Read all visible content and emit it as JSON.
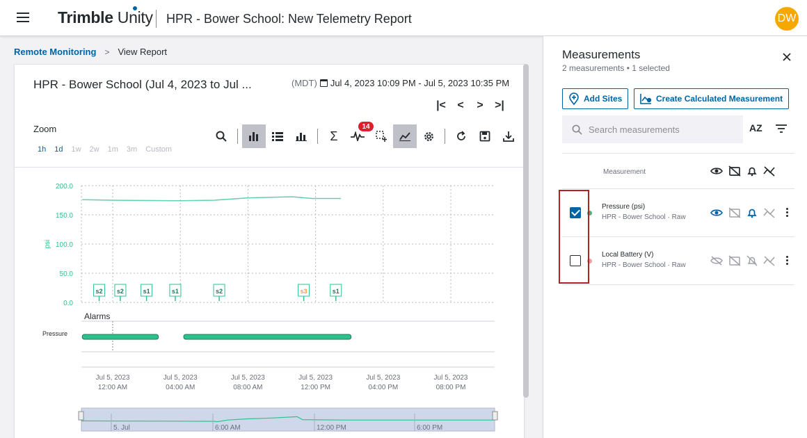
{
  "header": {
    "brand_bold": "Trimble",
    "brand_light": "Unity",
    "title": "HPR - Bower School: New Telemetry Report",
    "avatar": "DW"
  },
  "breadcrumb": {
    "parent": "Remote Monitoring",
    "sep": ">",
    "current": "View Report"
  },
  "report": {
    "title": "HPR - Bower School (Jul 4, 2023 to Jul ...",
    "timezone": "(MDT)",
    "range": "Jul 4, 2023 10:09 PM - Jul 5, 2023 10:35 PM",
    "zoom_label": "Zoom",
    "zoom_options": [
      "1h",
      "1d",
      "1w",
      "2w",
      "1m",
      "3m",
      "Custom"
    ],
    "alarm_badge": "14"
  },
  "chart_data": {
    "type": "line",
    "ylabel": "psi",
    "yticks": [
      "200.0",
      "150.0",
      "100.0",
      "50.0",
      "0.0"
    ],
    "ylim": [
      0,
      200
    ],
    "xticks": [
      {
        "date": "Jul 5, 2023",
        "time": "12:00 AM"
      },
      {
        "date": "Jul 5, 2023",
        "time": "04:00 AM"
      },
      {
        "date": "Jul 5, 2023",
        "time": "08:00 AM"
      },
      {
        "date": "Jul 5, 2023",
        "time": "12:00 PM"
      },
      {
        "date": "Jul 5, 2023",
        "time": "04:00 PM"
      },
      {
        "date": "Jul 5, 2023",
        "time": "08:00 PM"
      }
    ],
    "x_hours": [
      -1.8,
      0,
      4,
      6,
      8,
      10.6,
      11.8,
      13.5
    ],
    "series": [
      {
        "name": "Pressure",
        "color": "#5fd1b0",
        "y": [
          176,
          175,
          174,
          175,
          179,
          181,
          178,
          178
        ]
      }
    ],
    "events": [
      {
        "label": "s2",
        "h": -0.8
      },
      {
        "label": "s2",
        "h": 0.45
      },
      {
        "label": "s1",
        "h": 2.0
      },
      {
        "label": "s1",
        "h": 3.7
      },
      {
        "label": "s2",
        "h": 6.3
      },
      {
        "label": "s3",
        "h": 11.3
      },
      {
        "label": "s1",
        "h": 13.2
      }
    ],
    "alarms_label": "Alarms",
    "alarm_row": "Pressure",
    "alarm_spans": [
      [
        -1.8,
        2.7
      ],
      [
        4.2,
        14.1
      ]
    ],
    "navigator_labels": [
      "5. Jul",
      "6:00 AM",
      "12:00 PM",
      "6:00 PM"
    ],
    "grid": true
  },
  "panel": {
    "title": "Measurements",
    "subtitle": "2 measurements • 1 selected",
    "add_sites": "Add Sites",
    "create_calc": "Create Calculated Measurement",
    "search_placeholder": "Search measurements",
    "sort_label": "AZ",
    "column_label": "Measurement",
    "rows": [
      {
        "name": "Pressure (psi)",
        "sub": "HPR - Bower School · Raw",
        "checked": true,
        "dot": "#4caf7d"
      },
      {
        "name": "Local Battery (V)",
        "sub": "HPR - Bower School · Raw",
        "checked": false,
        "dot": "#e8a0a0"
      }
    ]
  },
  "colors": {
    "accent": "#0063a3",
    "series": "#5fd1b0",
    "alarm": "#2ec18d",
    "avatar": "#f5a800",
    "badge": "#da212c"
  }
}
